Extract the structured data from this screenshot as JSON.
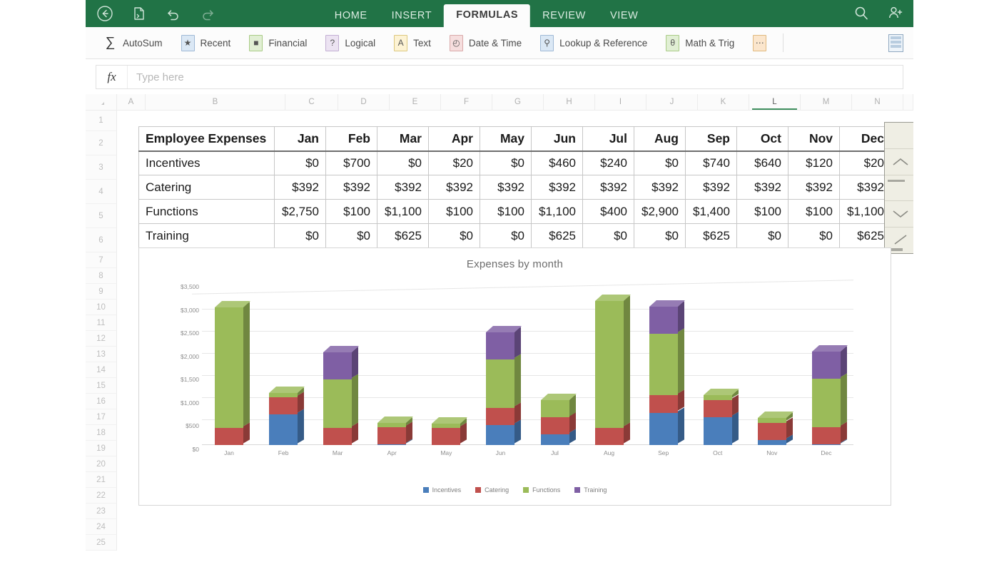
{
  "window": {
    "nav_icons": [
      "back-icon",
      "open-file-icon",
      "undo-icon",
      "redo-icon"
    ],
    "right_icons": [
      "search-icon",
      "share-person-icon"
    ]
  },
  "ribbon": {
    "tabs": [
      {
        "label": "HOME",
        "active": false
      },
      {
        "label": "INSERT",
        "active": false
      },
      {
        "label": "FORMULAS",
        "active": true
      },
      {
        "label": "REVIEW",
        "active": false
      },
      {
        "label": "VIEW",
        "active": false
      }
    ],
    "tools": [
      {
        "label": "AutoSum",
        "glyph": "∑",
        "style": "g-sigma"
      },
      {
        "label": "Recent",
        "glyph": "★",
        "style": "g-box g-recent"
      },
      {
        "label": "Financial",
        "glyph": "■",
        "style": "g-box g-financial"
      },
      {
        "label": "Logical",
        "glyph": "?",
        "style": "g-box g-logical"
      },
      {
        "label": "Text",
        "glyph": "A",
        "style": "g-box g-text"
      },
      {
        "label": "Date & Time",
        "glyph": "◴",
        "style": "g-box g-date"
      },
      {
        "label": "Lookup & Reference",
        "glyph": "⚲",
        "style": "g-box g-lookup"
      },
      {
        "label": "Math & Trig",
        "glyph": "θ",
        "style": "g-box g-math"
      },
      {
        "label": "",
        "glyph": "⋯",
        "style": "g-box g-more"
      }
    ],
    "calculation_icon": "calculation-options-icon"
  },
  "formula_bar": {
    "fx_label": "fx",
    "placeholder": "Type here",
    "value": ""
  },
  "grid": {
    "columns": [
      "A",
      "B",
      "C",
      "D",
      "E",
      "F",
      "G",
      "H",
      "I",
      "J",
      "K",
      "L",
      "M",
      "N"
    ],
    "active_column": "L",
    "rows": [
      1,
      2,
      3,
      4,
      5,
      6,
      7,
      8,
      9,
      10,
      11,
      12,
      13,
      14,
      15,
      16,
      17,
      18,
      19,
      20,
      21,
      22,
      23,
      24,
      25
    ]
  },
  "table": {
    "corner_label": "Employee Expenses",
    "months": [
      "Jan",
      "Feb",
      "Mar",
      "Apr",
      "May",
      "Jun",
      "Jul",
      "Aug",
      "Sep",
      "Oct",
      "Nov",
      "Dec"
    ],
    "rows": [
      {
        "label": "Incentives",
        "values": [
          "$0",
          "$700",
          "$0",
          "$20",
          "$0",
          "$460",
          "$240",
          "$0",
          "$740",
          "$640",
          "$120",
          "$20"
        ]
      },
      {
        "label": "Catering",
        "values": [
          "$392",
          "$392",
          "$392",
          "$392",
          "$392",
          "$392",
          "$392",
          "$392",
          "$392",
          "$392",
          "$392",
          "$392"
        ]
      },
      {
        "label": "Functions",
        "values": [
          "$2,750",
          "$100",
          "$1,100",
          "$100",
          "$100",
          "$1,100",
          "$400",
          "$2,900",
          "$1,400",
          "$100",
          "$100",
          "$1,100"
        ]
      },
      {
        "label": "Training",
        "values": [
          "$0",
          "$0",
          "$625",
          "$0",
          "$0",
          "$625",
          "$0",
          "$0",
          "$625",
          "$0",
          "$0",
          "$625"
        ]
      }
    ]
  },
  "scrollbar": {
    "name": "vertical-scrollbar",
    "up_icon": "chevron-up-icon",
    "down_icon": "chevron-down-icon"
  },
  "chart_data": {
    "type": "bar",
    "subtype": "stacked-3d-column",
    "title": "Expenses by month",
    "xlabel": "",
    "ylabel": "",
    "categories": [
      "Jan",
      "Feb",
      "Mar",
      "Apr",
      "May",
      "Jun",
      "Jul",
      "Aug",
      "Sep",
      "Oct",
      "Nov",
      "Dec"
    ],
    "ylim": [
      0,
      3500
    ],
    "ytick_labels": [
      "$0",
      "$500",
      "$1,000",
      "$1,500",
      "$2,000",
      "$2,500",
      "$3,000",
      "$3,500"
    ],
    "yticks": [
      0,
      500,
      1000,
      1500,
      2000,
      2500,
      3000,
      3500
    ],
    "grid": true,
    "legend_position": "bottom",
    "series": [
      {
        "name": "Incentives",
        "color": "#4A7EBB",
        "values": [
          0,
          700,
          0,
          20,
          0,
          460,
          240,
          0,
          740,
          640,
          120,
          20
        ]
      },
      {
        "name": "Catering",
        "color": "#C0504D",
        "values": [
          392,
          392,
          392,
          392,
          392,
          392,
          392,
          392,
          392,
          392,
          392,
          392
        ]
      },
      {
        "name": "Functions",
        "color": "#9BBB59",
        "values": [
          2750,
          100,
          1100,
          100,
          100,
          1100,
          400,
          2900,
          1400,
          100,
          100,
          1100
        ]
      },
      {
        "name": "Training",
        "color": "#7F5FA4",
        "values": [
          0,
          0,
          625,
          0,
          0,
          625,
          0,
          0,
          625,
          0,
          0,
          625
        ]
      }
    ],
    "totals": [
      3142,
      1192,
      2117,
      512,
      492,
      2577,
      1032,
      3292,
      3157,
      1132,
      612,
      2137
    ]
  },
  "colors": {
    "brand_green": "#217346",
    "active_col_underline": "#3f8f5f",
    "incentives": "#4A7EBB",
    "catering": "#C0504D",
    "functions": "#9BBB59",
    "training": "#7F5FA4"
  }
}
